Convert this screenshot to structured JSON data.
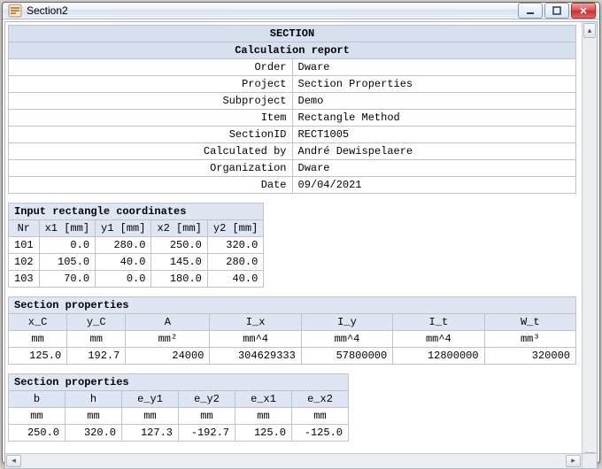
{
  "window": {
    "title": "Section2"
  },
  "report": {
    "heading": "SECTION",
    "subheading": "Calculation report",
    "meta": {
      "order_label": "Order",
      "order_value": "Dware",
      "project_label": "Project",
      "project_value": "Section Properties",
      "subproject_label": "Subproject",
      "subproject_value": "Demo",
      "item_label": "Item",
      "item_value": "Rectangle Method",
      "sectionid_label": "SectionID",
      "sectionid_value": "RECT1005",
      "calcby_label": "Calculated by",
      "calcby_value": "André Dewispelaere",
      "org_label": "Organization",
      "org_value": "Dware",
      "date_label": "Date",
      "date_value": "09/04/2021"
    }
  },
  "input": {
    "caption": "Input rectangle coordinates",
    "headers": {
      "nr": "Nr",
      "x1": "x1 [mm]",
      "y1": "y1 [mm]",
      "x2": "x2 [mm]",
      "y2": "y2 [mm]"
    },
    "rows": [
      {
        "nr": "101",
        "x1": "0.0",
        "y1": "280.0",
        "x2": "250.0",
        "y2": "320.0"
      },
      {
        "nr": "102",
        "x1": "105.0",
        "y1": "40.0",
        "x2": "145.0",
        "y2": "280.0"
      },
      {
        "nr": "103",
        "x1": "70.0",
        "y1": "0.0",
        "x2": "180.0",
        "y2": "40.0"
      }
    ]
  },
  "props1": {
    "caption": "Section properties",
    "headers": {
      "xc": "x_C",
      "yc": "y_C",
      "a": "A",
      "ix": "I_x",
      "iy": "I_y",
      "it": "I_t",
      "wt": "W_t"
    },
    "units": {
      "xc": "mm",
      "yc": "mm",
      "a": "mm²",
      "ix": "mm^4",
      "iy": "mm^4",
      "it": "mm^4",
      "wt": "mm³"
    },
    "values": {
      "xc": "125.0",
      "yc": "192.7",
      "a": "24000",
      "ix": "304629333",
      "iy": "57800000",
      "it": "12800000",
      "wt": "320000"
    }
  },
  "props2": {
    "caption": "Section properties",
    "headers": {
      "b": "b",
      "h": "h",
      "ey1": "e_y1",
      "ey2": "e_y2",
      "ex1": "e_x1",
      "ex2": "e_x2"
    },
    "units": {
      "b": "mm",
      "h": "mm",
      "ey1": "mm",
      "ey2": "mm",
      "ex1": "mm",
      "ex2": "mm"
    },
    "values": {
      "b": "250.0",
      "h": "320.0",
      "ey1": "127.3",
      "ey2": "-192.7",
      "ex1": "125.0",
      "ex2": "-125.0"
    }
  }
}
